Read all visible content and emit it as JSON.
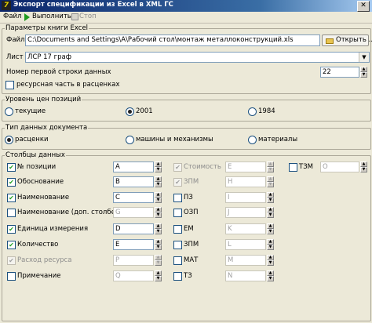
{
  "window": {
    "title": "Экспорт спецификации из Excel в XML ГС",
    "app_icon": "7",
    "close": "✕"
  },
  "menu": {
    "file": "Файл",
    "run": "Выполнить",
    "stop": "Стоп"
  },
  "excel": {
    "group_title": "Параметры книги Excel",
    "file_label": "Файл",
    "file_path": "C:\\Documents and Settings\\A\\Рабочий стол\\монтаж металлоконструкций.xls",
    "open_button": "Открыть ...",
    "sheet_label": "Лист",
    "sheet_value": "ЛСР 17 граф",
    "first_row_label": "Номер первой строки данных",
    "first_row_value": "22",
    "resource_label": "ресурсная часть в расценках",
    "resource_checked": false
  },
  "price_level": {
    "title": "Уровень цен позиций",
    "options": [
      "текущие",
      "2001",
      "1984"
    ],
    "selected": "2001"
  },
  "doc_type": {
    "title": "Тип данных документа",
    "options": [
      "расценки",
      "машины и механизмы",
      "материалы"
    ],
    "selected": "расценки"
  },
  "columns": {
    "title": "Столбцы данных",
    "col1": [
      {
        "label": "№ позиции",
        "checked": true,
        "enabled": true,
        "value": "A"
      },
      {
        "label": "Обоснование",
        "checked": true,
        "enabled": true,
        "value": "B"
      },
      {
        "label": "Наименование",
        "checked": true,
        "enabled": true,
        "value": "C"
      },
      {
        "label": "Наименование (доп. столбец)",
        "checked": false,
        "enabled": true,
        "value": "G"
      },
      {
        "label": "Единица измерения",
        "checked": true,
        "enabled": true,
        "value": "D"
      },
      {
        "label": "Количество",
        "checked": true,
        "enabled": true,
        "value": "E"
      },
      {
        "label": "Расход ресурса",
        "checked": true,
        "enabled": false,
        "value": "P"
      },
      {
        "label": "Примечание",
        "checked": false,
        "enabled": true,
        "value": "Q"
      }
    ],
    "col2": [
      {
        "label": "Стоимость",
        "checked": true,
        "enabled": false,
        "value": "E"
      },
      {
        "label": "ЗПМ",
        "checked": true,
        "enabled": false,
        "value": "H"
      },
      {
        "label": "ПЗ",
        "checked": false,
        "enabled": true,
        "value": "I"
      },
      {
        "label": "ОЗП",
        "checked": false,
        "enabled": true,
        "value": "J"
      },
      {
        "label": "ЕМ",
        "checked": false,
        "enabled": true,
        "value": "K"
      },
      {
        "label": "ЗПМ",
        "checked": false,
        "enabled": true,
        "value": "L"
      },
      {
        "label": "МАТ",
        "checked": false,
        "enabled": true,
        "value": "M"
      },
      {
        "label": "ТЗ",
        "checked": false,
        "enabled": true,
        "value": "N"
      }
    ],
    "col3": {
      "label": "ТЗМ",
      "checked": false,
      "enabled": true,
      "value": "O"
    }
  },
  "icons": {
    "run": "play-icon",
    "stop": "stop-icon",
    "open": "folder-icon",
    "check": "✔",
    "dropdown": "▼",
    "spin_up": "▲",
    "spin_down": "▼"
  },
  "colors": {
    "title_bar": "#0a246a",
    "check_mark": "#21a121",
    "window_bg": "#ece9d8"
  }
}
